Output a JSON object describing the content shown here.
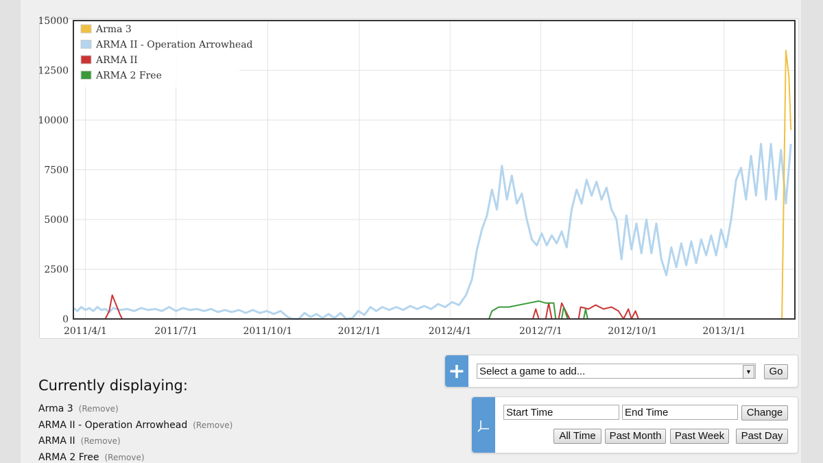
{
  "chart_data": {
    "type": "line",
    "title": "",
    "xlabel": "",
    "ylabel": "",
    "x_unit": "days since 2011/4/1",
    "xlim": [
      -12,
      712
    ],
    "ylim": [
      0,
      15000
    ],
    "grid": true,
    "legend_position": "top-left",
    "y_ticks": [
      0,
      2500,
      5000,
      7500,
      10000,
      12500,
      15000
    ],
    "x_ticks": [
      {
        "value": 0,
        "label": "2011/4/1"
      },
      {
        "value": 91,
        "label": "2011/7/1"
      },
      {
        "value": 183,
        "label": "2011/10/1"
      },
      {
        "value": 275,
        "label": "2012/1/1"
      },
      {
        "value": 366,
        "label": "2012/4/1"
      },
      {
        "value": 457,
        "label": "2012/7/1"
      },
      {
        "value": 549,
        "label": "2012/10/1"
      },
      {
        "value": 641,
        "label": "2013/1/1"
      }
    ],
    "series": [
      {
        "name": "Arma 3",
        "color": "#f0c040",
        "points": [
          [
            -12,
            0
          ],
          [
            699,
            0
          ],
          [
            703,
            13500
          ],
          [
            706,
            12200
          ],
          [
            708,
            9500
          ]
        ]
      },
      {
        "name": "ARMA II - Operation Arrowhead",
        "color": "#b4d5ee",
        "points": [
          [
            -12,
            550
          ],
          [
            -8,
            400
          ],
          [
            -4,
            600
          ],
          [
            0,
            450
          ],
          [
            4,
            550
          ],
          [
            8,
            400
          ],
          [
            12,
            600
          ],
          [
            16,
            450
          ],
          [
            20,
            500
          ],
          [
            24,
            350
          ],
          [
            28,
            550
          ],
          [
            35,
            450
          ],
          [
            42,
            500
          ],
          [
            49,
            400
          ],
          [
            56,
            550
          ],
          [
            63,
            450
          ],
          [
            70,
            500
          ],
          [
            77,
            400
          ],
          [
            84,
            600
          ],
          [
            91,
            400
          ],
          [
            98,
            550
          ],
          [
            105,
            450
          ],
          [
            112,
            500
          ],
          [
            119,
            400
          ],
          [
            126,
            500
          ],
          [
            133,
            350
          ],
          [
            140,
            450
          ],
          [
            147,
            350
          ],
          [
            154,
            450
          ],
          [
            161,
            300
          ],
          [
            168,
            450
          ],
          [
            175,
            300
          ],
          [
            182,
            400
          ],
          [
            189,
            250
          ],
          [
            196,
            400
          ],
          [
            203,
            100
          ],
          [
            208,
            0
          ],
          [
            214,
            0
          ],
          [
            220,
            300
          ],
          [
            226,
            100
          ],
          [
            232,
            250
          ],
          [
            238,
            50
          ],
          [
            244,
            250
          ],
          [
            250,
            50
          ],
          [
            256,
            300
          ],
          [
            262,
            0
          ],
          [
            268,
            50
          ],
          [
            274,
            400
          ],
          [
            280,
            200
          ],
          [
            286,
            600
          ],
          [
            292,
            400
          ],
          [
            298,
            600
          ],
          [
            305,
            450
          ],
          [
            312,
            600
          ],
          [
            319,
            450
          ],
          [
            326,
            650
          ],
          [
            333,
            500
          ],
          [
            340,
            650
          ],
          [
            347,
            500
          ],
          [
            354,
            750
          ],
          [
            361,
            600
          ],
          [
            368,
            850
          ],
          [
            375,
            700
          ],
          [
            382,
            1200
          ],
          [
            388,
            2000
          ],
          [
            393,
            3500
          ],
          [
            398,
            4500
          ],
          [
            403,
            5200
          ],
          [
            408,
            6500
          ],
          [
            413,
            5500
          ],
          [
            418,
            7700
          ],
          [
            423,
            6000
          ],
          [
            428,
            7200
          ],
          [
            433,
            5800
          ],
          [
            438,
            6300
          ],
          [
            443,
            5000
          ],
          [
            448,
            4000
          ],
          [
            453,
            3700
          ],
          [
            458,
            4300
          ],
          [
            463,
            3700
          ],
          [
            468,
            4200
          ],
          [
            473,
            3800
          ],
          [
            478,
            4400
          ],
          [
            483,
            3600
          ],
          [
            488,
            5500
          ],
          [
            493,
            6500
          ],
          [
            498,
            5800
          ],
          [
            503,
            7000
          ],
          [
            508,
            6200
          ],
          [
            513,
            6900
          ],
          [
            518,
            6000
          ],
          [
            523,
            6600
          ],
          [
            528,
            5500
          ],
          [
            533,
            5000
          ],
          [
            538,
            3000
          ],
          [
            543,
            5200
          ],
          [
            548,
            3500
          ],
          [
            553,
            4800
          ],
          [
            558,
            3300
          ],
          [
            563,
            5000
          ],
          [
            568,
            3300
          ],
          [
            573,
            4800
          ],
          [
            578,
            3000
          ],
          [
            583,
            2200
          ],
          [
            588,
            3600
          ],
          [
            593,
            2600
          ],
          [
            598,
            3800
          ],
          [
            603,
            2700
          ],
          [
            608,
            3900
          ],
          [
            613,
            2800
          ],
          [
            618,
            4000
          ],
          [
            623,
            3200
          ],
          [
            628,
            4200
          ],
          [
            633,
            3200
          ],
          [
            638,
            4500
          ],
          [
            643,
            3600
          ],
          [
            648,
            5000
          ],
          [
            653,
            7000
          ],
          [
            658,
            7600
          ],
          [
            663,
            6000
          ],
          [
            668,
            8200
          ],
          [
            673,
            6200
          ],
          [
            678,
            8800
          ],
          [
            683,
            6000
          ],
          [
            688,
            8800
          ],
          [
            693,
            6000
          ],
          [
            698,
            8500
          ],
          [
            703,
            5800
          ],
          [
            708,
            8800
          ]
        ]
      },
      {
        "name": "ARMA II",
        "color": "#cc3333",
        "points": [
          [
            -12,
            0
          ],
          [
            20,
            0
          ],
          [
            24,
            400
          ],
          [
            27,
            1200
          ],
          [
            31,
            700
          ],
          [
            35,
            200
          ],
          [
            37,
            0
          ],
          [
            449,
            0
          ],
          [
            452,
            500
          ],
          [
            455,
            0
          ],
          [
            462,
            0
          ],
          [
            465,
            800
          ],
          [
            468,
            0
          ],
          [
            475,
            0
          ],
          [
            478,
            800
          ],
          [
            482,
            400
          ],
          [
            486,
            0
          ],
          [
            495,
            0
          ],
          [
            497,
            600
          ],
          [
            505,
            500
          ],
          [
            512,
            700
          ],
          [
            520,
            500
          ],
          [
            528,
            600
          ],
          [
            535,
            400
          ],
          [
            540,
            0
          ],
          [
            545,
            500
          ],
          [
            548,
            0
          ],
          [
            552,
            400
          ],
          [
            555,
            0
          ],
          [
            708,
            0
          ]
        ]
      },
      {
        "name": "ARMA 2 Free",
        "color": "#3a9a3a",
        "points": [
          [
            -12,
            0
          ],
          [
            405,
            0
          ],
          [
            408,
            400
          ],
          [
            415,
            600
          ],
          [
            425,
            600
          ],
          [
            435,
            700
          ],
          [
            445,
            800
          ],
          [
            455,
            900
          ],
          [
            462,
            800
          ],
          [
            470,
            800
          ],
          [
            472,
            0
          ],
          [
            478,
            0
          ],
          [
            480,
            600
          ],
          [
            484,
            0
          ],
          [
            500,
            0
          ],
          [
            502,
            500
          ],
          [
            504,
            0
          ],
          [
            708,
            0
          ]
        ]
      }
    ]
  },
  "current": {
    "title": "Currently displaying:",
    "remove_label": "(Remove)",
    "items": [
      "Arma 3",
      "ARMA II - Operation Arrowhead",
      "ARMA II",
      "ARMA 2 Free"
    ]
  },
  "add_panel": {
    "icon": "plus-icon",
    "select_value": "Select a game to add...",
    "go_label": "Go"
  },
  "time_panel": {
    "icon": "axes-icon",
    "start_placeholder": "Start Time",
    "end_placeholder": "End Time",
    "change_label": "Change",
    "presets": [
      "All Time",
      "Past Month",
      "Past Week",
      "Past Day"
    ]
  },
  "colors": {
    "accent": "#5b9bd5"
  }
}
